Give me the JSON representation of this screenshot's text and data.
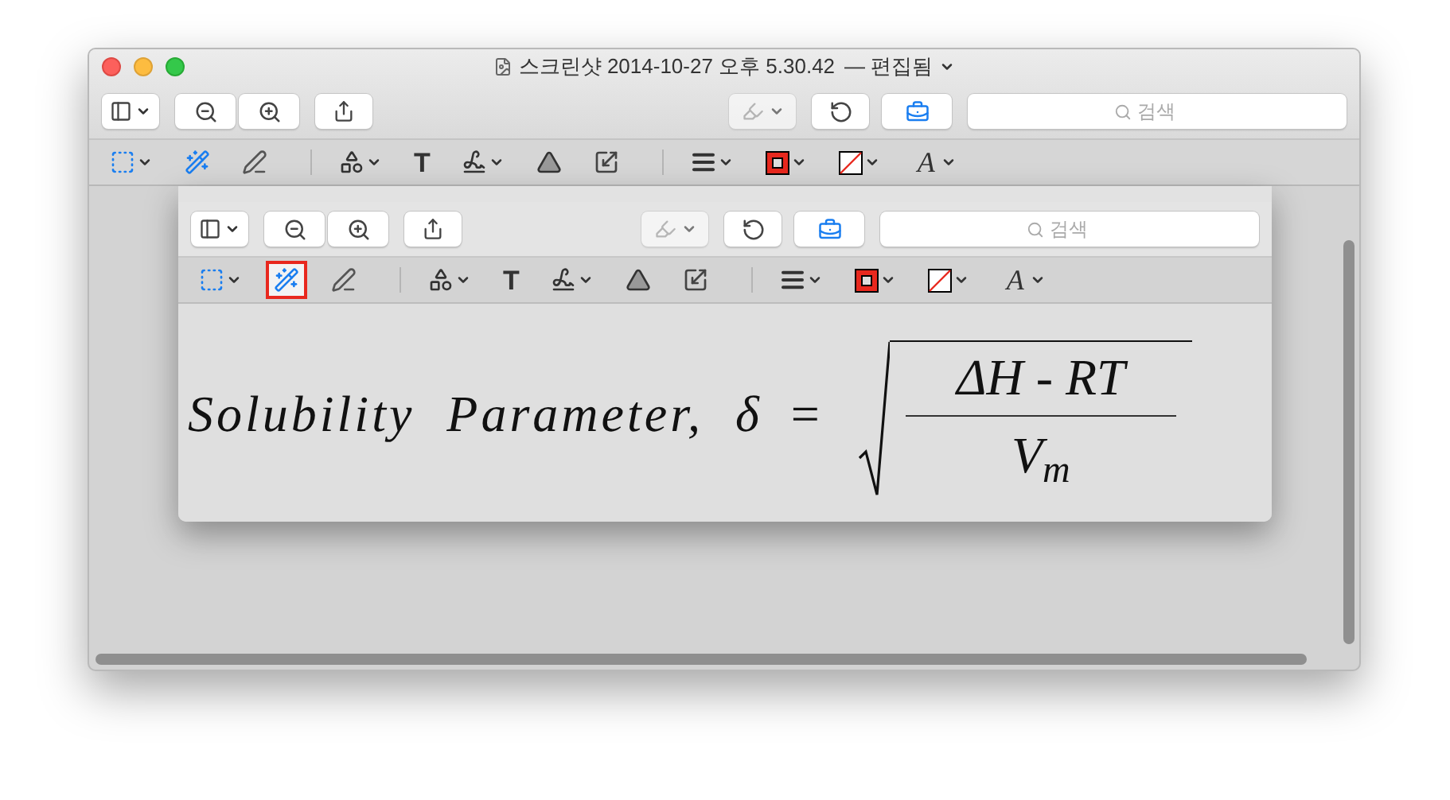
{
  "window": {
    "title": "스크린샷 2014-10-27 오후 5.30.42",
    "status": "— 편집됨"
  },
  "toolbar": {
    "search": {
      "placeholder": "검색"
    }
  },
  "annotation_groups": [
    {
      "tools": [
        {
          "kind": "select",
          "menu": true,
          "selected": false
        },
        {
          "kind": "instant-alpha",
          "menu": false,
          "selected": false
        },
        {
          "kind": "sketch",
          "menu": false,
          "selected": false
        }
      ]
    },
    {
      "tools": [
        {
          "kind": "shapes",
          "menu": true,
          "selected": false
        },
        {
          "kind": "text",
          "menu": false,
          "selected": false,
          "glyph": "T"
        },
        {
          "kind": "sign",
          "menu": true,
          "selected": false
        },
        {
          "kind": "adjust-color",
          "menu": false,
          "selected": false
        },
        {
          "kind": "adjust-size",
          "menu": false,
          "selected": false
        }
      ]
    },
    {
      "tools": [
        {
          "kind": "line-style",
          "menu": true,
          "selected": false
        },
        {
          "kind": "border-color",
          "menu": true,
          "selected": false
        },
        {
          "kind": "fill-color",
          "menu": true,
          "selected": false
        },
        {
          "kind": "font",
          "menu": true,
          "selected": false,
          "glyph": "A"
        }
      ]
    }
  ],
  "document": {
    "toolbar": {
      "search": {
        "placeholder": "검색"
      }
    },
    "annotation_groups": [
      {
        "tools": [
          {
            "kind": "select",
            "menu": true,
            "selected": false
          },
          {
            "kind": "instant-alpha",
            "menu": false,
            "selected": true
          },
          {
            "kind": "sketch",
            "menu": false,
            "selected": false
          }
        ]
      },
      {
        "tools": [
          {
            "kind": "shapes",
            "menu": true,
            "selected": false
          },
          {
            "kind": "text",
            "menu": false,
            "selected": false,
            "glyph": "T"
          },
          {
            "kind": "sign",
            "menu": true,
            "selected": false
          },
          {
            "kind": "adjust-color",
            "menu": false,
            "selected": false
          },
          {
            "kind": "adjust-size",
            "menu": false,
            "selected": false
          }
        ]
      },
      {
        "tools": [
          {
            "kind": "line-style",
            "menu": true,
            "selected": false
          },
          {
            "kind": "border-color",
            "menu": true,
            "selected": false
          },
          {
            "kind": "fill-color",
            "menu": true,
            "selected": false
          },
          {
            "kind": "font",
            "menu": true,
            "selected": false,
            "glyph": "A"
          }
        ]
      }
    ],
    "equation": {
      "label": "Solubility Parameter,",
      "symbol": "δ",
      "equals": "=",
      "numerator": "ΔH - RT",
      "denominator": "V$_{m}$"
    }
  }
}
